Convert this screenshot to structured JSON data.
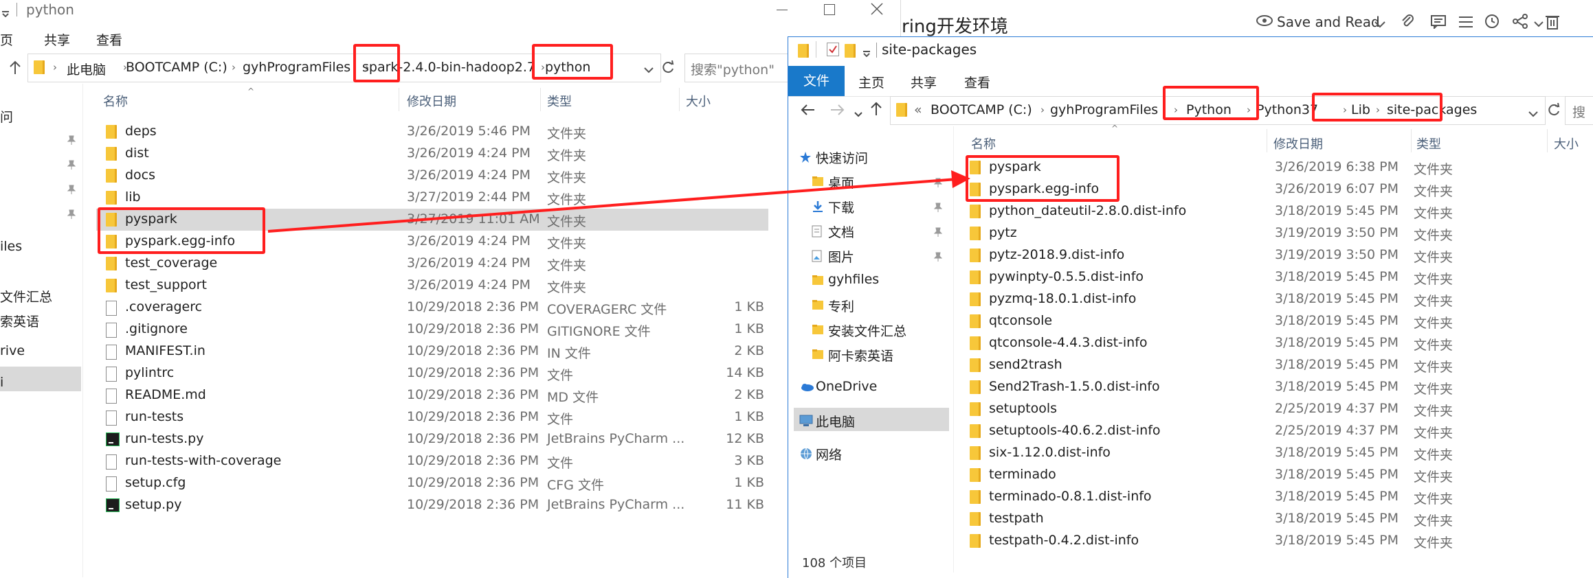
{
  "colors": {
    "highlight_red": "#ff1e1e",
    "file_tab_blue": "#1979ca",
    "selection_gray": "#d9d9d9",
    "folder_yellow": "#f7c73a"
  },
  "bg_doc": {
    "title": "ring开发环境",
    "save_read": "Save and Read",
    "icons": [
      "eye-icon",
      "chevron-down-icon",
      "attach-icon",
      "comment-icon",
      "list-icon",
      "history-icon",
      "share-icon",
      "delete-icon"
    ]
  },
  "left": {
    "title": "python",
    "ribbon": {
      "t1": "页",
      "t2": "共享",
      "t3": "查看"
    },
    "address": {
      "c1": "此电脑",
      "c2": "BOOTCAMP (C:)",
      "c3": "gyhProgramFiles",
      "c4": "spark",
      "c5": "-2.4.0-bin-hadoop2.7",
      "c6": "python"
    },
    "search_placeholder": "搜索\"python\"",
    "columns": {
      "name": "名称",
      "date": "修改日期",
      "type": "类型",
      "size": "大小"
    },
    "nav": [
      "问",
      "iles",
      "文件汇总",
      "索英语",
      "rive",
      "i"
    ],
    "rows": [
      {
        "icon": "folder",
        "name": "deps",
        "date": "3/26/2019 5:46 PM",
        "type": "文件夹",
        "size": ""
      },
      {
        "icon": "folder",
        "name": "dist",
        "date": "3/26/2019 4:24 PM",
        "type": "文件夹",
        "size": ""
      },
      {
        "icon": "folder",
        "name": "docs",
        "date": "3/26/2019 4:24 PM",
        "type": "文件夹",
        "size": ""
      },
      {
        "icon": "folder",
        "name": "lib",
        "date": "3/27/2019 2:44 PM",
        "type": "文件夹",
        "size": ""
      },
      {
        "icon": "folder",
        "name": "pyspark",
        "date": "3/27/2019 11:01 AM",
        "type": "文件夹",
        "size": ""
      },
      {
        "icon": "folder",
        "name": "pyspark.egg-info",
        "date": "3/26/2019 4:24 PM",
        "type": "文件夹",
        "size": ""
      },
      {
        "icon": "folder",
        "name": "test_coverage",
        "date": "3/26/2019 4:24 PM",
        "type": "文件夹",
        "size": ""
      },
      {
        "icon": "folder",
        "name": "test_support",
        "date": "3/26/2019 4:24 PM",
        "type": "文件夹",
        "size": ""
      },
      {
        "icon": "file",
        "name": ".coveragerc",
        "date": "10/29/2018 2:36 PM",
        "type": "COVERAGERC 文件",
        "size": "1 KB"
      },
      {
        "icon": "file",
        "name": ".gitignore",
        "date": "10/29/2018 2:36 PM",
        "type": "GITIGNORE 文件",
        "size": "1 KB"
      },
      {
        "icon": "file",
        "name": "MANIFEST.in",
        "date": "10/29/2018 2:36 PM",
        "type": "IN 文件",
        "size": "2 KB"
      },
      {
        "icon": "file",
        "name": "pylintrc",
        "date": "10/29/2018 2:36 PM",
        "type": "文件",
        "size": "14 KB"
      },
      {
        "icon": "file",
        "name": "README.md",
        "date": "10/29/2018 2:36 PM",
        "type": "MD 文件",
        "size": "2 KB"
      },
      {
        "icon": "file",
        "name": "run-tests",
        "date": "10/29/2018 2:36 PM",
        "type": "文件",
        "size": "1 KB"
      },
      {
        "icon": "pycharm",
        "name": "run-tests.py",
        "date": "10/29/2018 2:36 PM",
        "type": "JetBrains PyCharm ...",
        "size": "12 KB"
      },
      {
        "icon": "file",
        "name": "run-tests-with-coverage",
        "date": "10/29/2018 2:36 PM",
        "type": "文件",
        "size": "3 KB"
      },
      {
        "icon": "file",
        "name": "setup.cfg",
        "date": "10/29/2018 2:36 PM",
        "type": "CFG 文件",
        "size": "1 KB"
      },
      {
        "icon": "pycharm",
        "name": "setup.py",
        "date": "10/29/2018 2:36 PM",
        "type": "JetBrains PyCharm ...",
        "size": "11 KB"
      }
    ]
  },
  "right": {
    "title": "site-packages",
    "ribbon": {
      "file": "文件",
      "home": "主页",
      "share": "共享",
      "view": "查看"
    },
    "address": {
      "c0": "«",
      "c1": "BOOTCAMP (C:)",
      "c2": "gyhProgramFiles",
      "c3": "Python",
      "c4": "Python37",
      "c5": "Lib",
      "c6": "site-packages"
    },
    "search_placeholder": "搜",
    "columns": {
      "name": "名称",
      "date": "修改日期",
      "type": "类型",
      "size": "大小"
    },
    "nav": [
      {
        "label": "快速访问",
        "icon": "star-icon"
      },
      {
        "label": "桌面",
        "icon": "folder-icon"
      },
      {
        "label": "下载",
        "icon": "download-icon"
      },
      {
        "label": "文档",
        "icon": "document-icon"
      },
      {
        "label": "图片",
        "icon": "picture-icon"
      },
      {
        "label": "gyhfiles",
        "icon": "folder-icon"
      },
      {
        "label": "专利",
        "icon": "folder-icon"
      },
      {
        "label": "安装文件汇总",
        "icon": "folder-icon"
      },
      {
        "label": "阿卡索英语",
        "icon": "folder-icon"
      },
      {
        "label": "OneDrive",
        "icon": "cloud-icon"
      },
      {
        "label": "此电脑",
        "icon": "computer-icon"
      },
      {
        "label": "网络",
        "icon": "network-icon"
      }
    ],
    "rows": [
      {
        "name": "pyspark",
        "date": "3/26/2019 6:38 PM",
        "type": "文件夹"
      },
      {
        "name": "pyspark.egg-info",
        "date": "3/26/2019 6:07 PM",
        "type": "文件夹"
      },
      {
        "name": "python_dateutil-2.8.0.dist-info",
        "date": "3/18/2019 5:45 PM",
        "type": "文件夹"
      },
      {
        "name": "pytz",
        "date": "3/19/2019 3:50 PM",
        "type": "文件夹"
      },
      {
        "name": "pytz-2018.9.dist-info",
        "date": "3/19/2019 3:50 PM",
        "type": "文件夹"
      },
      {
        "name": "pywinpty-0.5.5.dist-info",
        "date": "3/18/2019 5:45 PM",
        "type": "文件夹"
      },
      {
        "name": "pyzmq-18.0.1.dist-info",
        "date": "3/18/2019 5:45 PM",
        "type": "文件夹"
      },
      {
        "name": "qtconsole",
        "date": "3/18/2019 5:45 PM",
        "type": "文件夹"
      },
      {
        "name": "qtconsole-4.4.3.dist-info",
        "date": "3/18/2019 5:45 PM",
        "type": "文件夹"
      },
      {
        "name": "send2trash",
        "date": "3/18/2019 5:45 PM",
        "type": "文件夹"
      },
      {
        "name": "Send2Trash-1.5.0.dist-info",
        "date": "3/18/2019 5:45 PM",
        "type": "文件夹"
      },
      {
        "name": "setuptools",
        "date": "2/25/2019 4:37 PM",
        "type": "文件夹"
      },
      {
        "name": "setuptools-40.6.2.dist-info",
        "date": "2/25/2019 4:37 PM",
        "type": "文件夹"
      },
      {
        "name": "six-1.12.0.dist-info",
        "date": "3/18/2019 5:45 PM",
        "type": "文件夹"
      },
      {
        "name": "terminado",
        "date": "3/18/2019 5:45 PM",
        "type": "文件夹"
      },
      {
        "name": "terminado-0.8.1.dist-info",
        "date": "3/18/2019 5:45 PM",
        "type": "文件夹"
      },
      {
        "name": "testpath",
        "date": "3/18/2019 5:45 PM",
        "type": "文件夹"
      },
      {
        "name": "testpath-0.4.2.dist-info",
        "date": "3/18/2019 5:45 PM",
        "type": "文件夹"
      }
    ],
    "status": "108 个项目"
  }
}
